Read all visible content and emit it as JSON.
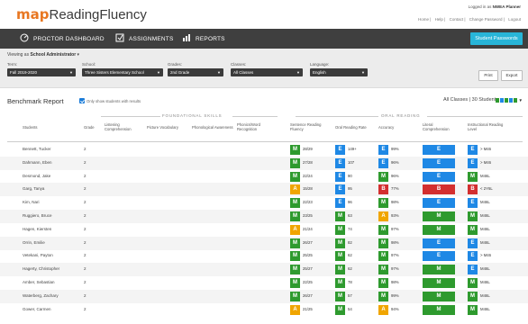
{
  "header": {
    "logo_map": "map",
    "logo_product": "ReadingFluency",
    "logged_in": "Logged in as",
    "user": "NWEA Planner",
    "links": [
      "Home",
      "Help",
      "Contact",
      "Change Password",
      "Logout"
    ]
  },
  "nav": {
    "items": [
      {
        "label": "PROCTOR DASHBOARD",
        "icon": "proctor-icon"
      },
      {
        "label": "ASSIGNMENTS",
        "icon": "assignments-icon"
      },
      {
        "label": "REPORTS",
        "icon": "reports-icon"
      }
    ],
    "student_passwords": "Student Passwords"
  },
  "filters": {
    "viewing_prefix": "Viewing as",
    "viewing_role": "School Administrator",
    "term": {
      "label": "Term:",
      "value": "Fall 2019-2020"
    },
    "school": {
      "label": "School:",
      "value": "Three Sisters Elementary School"
    },
    "grades": {
      "label": "Grades:",
      "value": "2nd Grade"
    },
    "classes": {
      "label": "Classes:",
      "value": "All Classes"
    },
    "language": {
      "label": "Language:",
      "value": "English"
    },
    "print": "Print",
    "export": "Export"
  },
  "report": {
    "title": "Benchmark Report",
    "checkbox_label": "Only show students with results",
    "summary": "All Classes | 30 Students",
    "legend_colors": [
      "#2e9a2e",
      "#1e88e5",
      "#2e9a2e",
      "#1e88e5",
      "#2e9a2e"
    ]
  },
  "table": {
    "foundational_label": "FOUNDATIONAL SKILLS",
    "oral_label": "ORAL READING",
    "columns": {
      "students": "Students",
      "grade": "Grade",
      "listening": "Listening Comprehension",
      "picture": "Picture Vocabulary",
      "phono": "Phonological Awareness",
      "phonics": "Phonics/Word Recognition",
      "sentence": "Sentence Reading Fluency",
      "oral": "Oral Reading Rate",
      "accuracy": "Accuracy",
      "literal": "Literal Comprehension",
      "instructional": "Instructional Reading Level"
    },
    "colors": {
      "M": "#2e9a2e",
      "E": "#1e88e5",
      "A": "#f0a500",
      "B": "#d32f2f"
    },
    "rows": [
      {
        "name": "Bennett, Tucker",
        "grade": "2",
        "s": "M",
        "sv": "28/29",
        "o": "E",
        "ov": "149+",
        "a": "E",
        "av": "99%",
        "l": "E",
        "i": "E",
        "iv": "> M46"
      },
      {
        "name": "Dahmann, Eben",
        "grade": "2",
        "s": "M",
        "sv": "27/28",
        "o": "E",
        "ov": "107",
        "a": "E",
        "av": "96%",
        "l": "E",
        "i": "E",
        "iv": "> M46"
      },
      {
        "name": "Desmond, Jake",
        "grade": "2",
        "s": "M",
        "sv": "22/24",
        "o": "E",
        "ov": "90",
        "a": "M",
        "av": "96%",
        "l": "E",
        "i": "M",
        "iv": "M46L"
      },
      {
        "name": "Garg, Tanya",
        "grade": "2",
        "s": "A",
        "sv": "15/28",
        "o": "E",
        "ov": "95",
        "a": "B",
        "av": "77%",
        "l": "B",
        "i": "B",
        "iv": "< 2Y6L"
      },
      {
        "name": "Kim, Nari",
        "grade": "2",
        "s": "M",
        "sv": "22/23",
        "o": "E",
        "ov": "96",
        "a": "M",
        "av": "98%",
        "l": "E",
        "i": "E",
        "iv": "M46L"
      },
      {
        "name": "Ruggiero, Bruce",
        "grade": "2",
        "s": "M",
        "sv": "23/25",
        "o": "M",
        "ov": "63",
        "a": "A",
        "av": "93%",
        "l": "M",
        "i": "M",
        "iv": "M46L"
      },
      {
        "name": "Hagen, Kiersten",
        "grade": "2",
        "s": "A",
        "sv": "21/24",
        "o": "M",
        "ov": "74",
        "a": "M",
        "av": "97%",
        "l": "M",
        "i": "M",
        "iv": "M46L"
      },
      {
        "name": "Orrin, Emilie",
        "grade": "2",
        "s": "M",
        "sv": "26/27",
        "o": "M",
        "ov": "82",
        "a": "M",
        "av": "98%",
        "l": "E",
        "i": "E",
        "iv": "M46L"
      },
      {
        "name": "Vetekani, Payton",
        "grade": "2",
        "s": "M",
        "sv": "25/25",
        "o": "M",
        "ov": "62",
        "a": "M",
        "av": "97%",
        "l": "E",
        "i": "E",
        "iv": "> M46"
      },
      {
        "name": "Hagerty, Christopher",
        "grade": "2",
        "s": "M",
        "sv": "25/27",
        "o": "M",
        "ov": "62",
        "a": "M",
        "av": "97%",
        "l": "M",
        "i": "E",
        "iv": "M46L"
      },
      {
        "name": "Amber, Sebastian",
        "grade": "2",
        "s": "M",
        "sv": "22/25",
        "o": "M",
        "ov": "78",
        "a": "M",
        "av": "98%",
        "l": "M",
        "i": "M",
        "iv": "M46L"
      },
      {
        "name": "Waterberg, Zachary",
        "grade": "2",
        "s": "M",
        "sv": "26/27",
        "o": "M",
        "ov": "57",
        "a": "M",
        "av": "99%",
        "l": "M",
        "i": "M",
        "iv": "M46L"
      },
      {
        "name": "Gower, Carmen",
        "grade": "2",
        "s": "A",
        "sv": "21/25",
        "o": "M",
        "ov": "54",
        "a": "A",
        "av": "94%",
        "l": "M",
        "i": "M",
        "iv": "M46L"
      }
    ]
  }
}
